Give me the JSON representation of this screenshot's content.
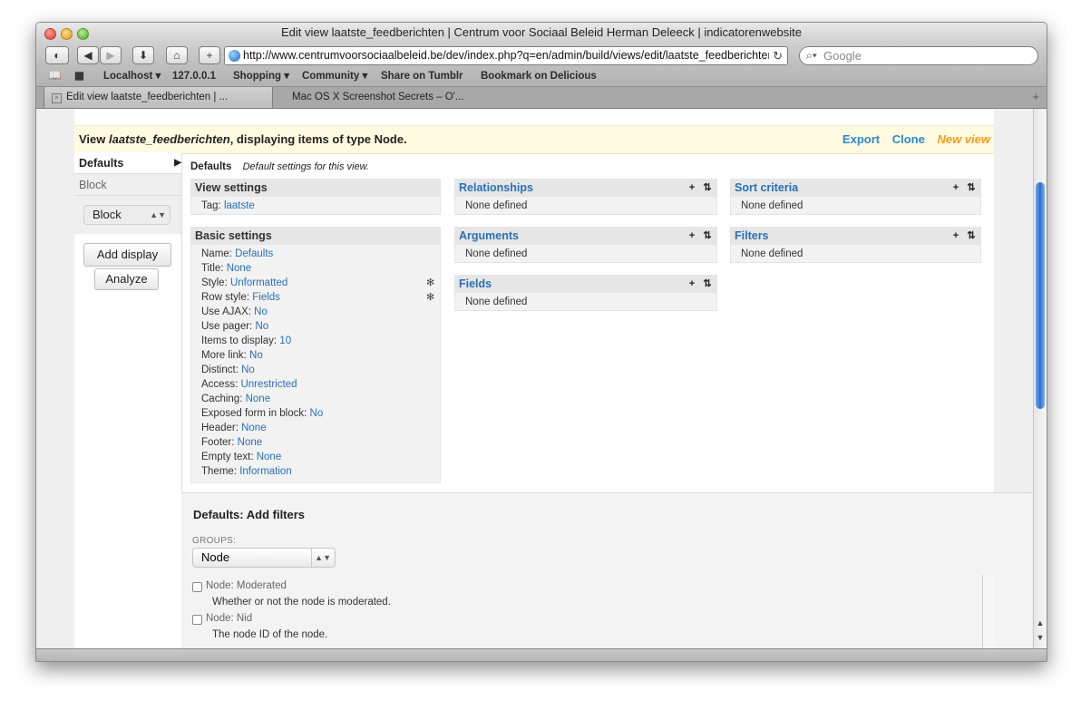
{
  "window": {
    "title": "Edit view laatste_feedberichten | Centrum voor Sociaal Beleid Herman Deleeck | indicatorenwebsite"
  },
  "toolbar": {
    "url": "http://www.centrumvoorsociaalbeleid.be/dev/index.php?q=en/admin/build/views/edit/laatste_feedberichten",
    "search_placeholder": "Google"
  },
  "bookmarks": [
    "Localhost ▾",
    "127.0.0.1",
    "Shopping ▾",
    "Community ▾",
    "Share on Tumblr",
    "Bookmark on Delicious"
  ],
  "tabs": [
    {
      "label": "Edit view laatste_feedberichten | ..."
    },
    {
      "label": "Mac OS X Screenshot Secrets – O'..."
    }
  ],
  "view_header": {
    "prefix": "View ",
    "name": "laatste_feedberichten",
    "suffix": ", displaying items of type Node.",
    "actions": [
      "Export",
      "Clone",
      "New view"
    ]
  },
  "displays": {
    "items": [
      "Defaults",
      "Block"
    ],
    "select_value": "Block",
    "add_display": "Add display",
    "analyze": "Analyze"
  },
  "main": {
    "title": "Defaults",
    "description": "Default settings for this view.",
    "view_settings": {
      "title": "View settings",
      "lines": [
        {
          "label": "Tag: ",
          "value": "laatste"
        }
      ]
    },
    "basic_settings": {
      "title": "Basic settings",
      "lines": [
        {
          "label": "Name: ",
          "value": "Defaults"
        },
        {
          "label": "Title: ",
          "value": "None"
        },
        {
          "label": "Style: ",
          "value": "Unformatted"
        },
        {
          "label": "Row style: ",
          "value": "Fields"
        },
        {
          "label": "Use AJAX: ",
          "value": "No"
        },
        {
          "label": "Use pager: ",
          "value": "No"
        },
        {
          "label": "Items to display: ",
          "value": "10"
        },
        {
          "label": "More link: ",
          "value": "No"
        },
        {
          "label": "Distinct: ",
          "value": "No"
        },
        {
          "label": "Access: ",
          "value": "Unrestricted"
        },
        {
          "label": "Caching: ",
          "value": "None"
        },
        {
          "label": "Exposed form in block: ",
          "value": "No"
        },
        {
          "label": "Header: ",
          "value": "None"
        },
        {
          "label": "Footer: ",
          "value": "None"
        },
        {
          "label": "Empty text: ",
          "value": "None"
        },
        {
          "label": "Theme: ",
          "value": "Information"
        }
      ]
    },
    "relationships": {
      "title": "Relationships",
      "value": "None defined"
    },
    "arguments": {
      "title": "Arguments",
      "value": "None defined"
    },
    "fields": {
      "title": "Fields",
      "value": "None defined"
    },
    "sort_criteria": {
      "title": "Sort criteria",
      "value": "None defined"
    },
    "filters": {
      "title": "Filters",
      "value": "None defined"
    }
  },
  "add_filters": {
    "title": "Defaults: Add filters",
    "groups_label": "GROUPS:",
    "group_value": "Node",
    "options": [
      {
        "label": "Node: Moderated",
        "description": "Whether or not the node is moderated."
      },
      {
        "label": "Node: Nid",
        "description": "The node ID of the node."
      }
    ]
  }
}
